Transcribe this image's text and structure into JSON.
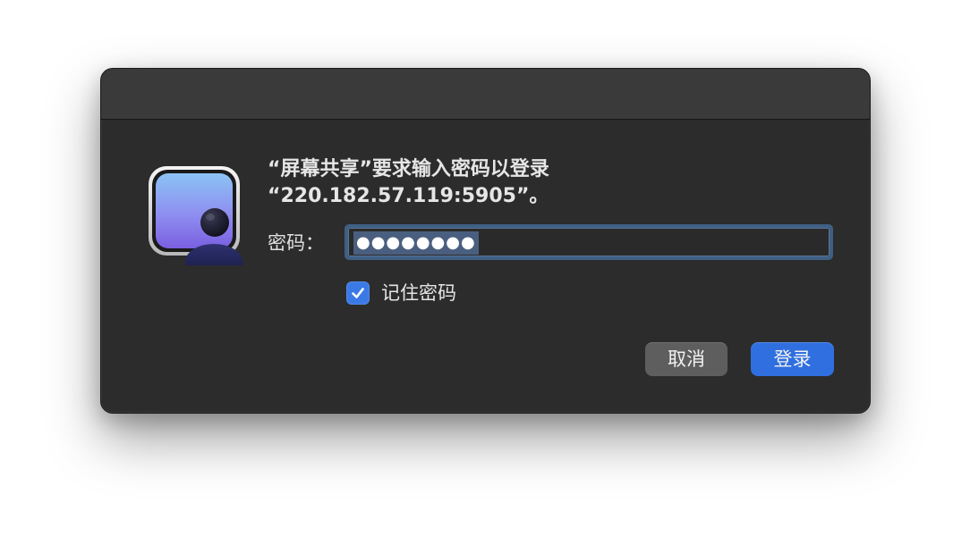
{
  "dialog": {
    "message_line1": "“屏幕共享”要求输入密码以登录",
    "message_line2": "“220.182.57.119:5905”。"
  },
  "password": {
    "label": "密码：",
    "value_masked": "●●●●●●●●"
  },
  "remember": {
    "label": "记住密码",
    "checked": true
  },
  "buttons": {
    "cancel_label": "取消",
    "login_label": "登录"
  },
  "icons": {
    "app": "screen-sharing-icon",
    "check": "checkmark-icon"
  },
  "colors": {
    "accent": "#2f6fe0",
    "checkbox": "#3b7ae6",
    "focus_ring": "#3f5f84",
    "dialog_bg": "#2c2c2c"
  }
}
